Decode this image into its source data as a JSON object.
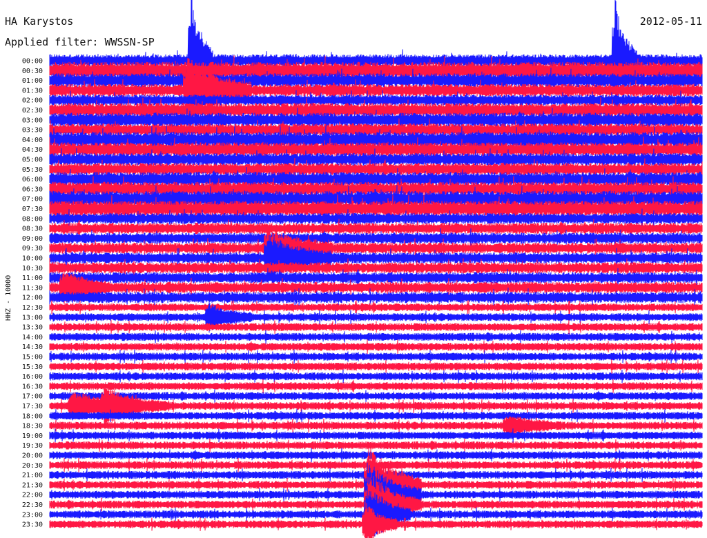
{
  "station": "HA Karystos",
  "date": "2012-05-11",
  "filter_label": "Applied filter: WWSSN-SP",
  "channel_label": "HHZ - 10000",
  "colors": {
    "red": "#ff1744",
    "blue": "#1a1aff"
  },
  "chart_data": {
    "type": "line",
    "title": "HA Karystos",
    "subtitle": "Applied filter: WWSSN-SP",
    "ylabel": "HHZ - 10000",
    "xlabel": "",
    "time_labels": [
      "00:00",
      "00:30",
      "01:00",
      "01:30",
      "02:00",
      "02:30",
      "03:00",
      "03:30",
      "04:00",
      "04:30",
      "05:00",
      "05:30",
      "06:00",
      "06:30",
      "07:00",
      "07:30",
      "08:00",
      "08:30",
      "09:00",
      "09:30",
      "10:00",
      "10:30",
      "11:00",
      "11:30",
      "12:00",
      "12:30",
      "13:00",
      "13:30",
      "14:00",
      "14:30",
      "15:00",
      "15:30",
      "16:00",
      "16:30",
      "17:00",
      "17:30",
      "18:00",
      "18:30",
      "19:00",
      "19:30",
      "20:00",
      "20:30",
      "21:00",
      "21:30",
      "22:00",
      "22:30",
      "23:00",
      "23:30"
    ],
    "trace_colors": [
      "blue",
      "red"
    ],
    "noise_level": [
      8,
      11,
      9,
      8,
      7,
      9,
      9,
      8,
      10,
      9,
      8,
      8,
      9,
      9,
      10,
      10,
      7,
      7,
      7,
      7,
      7,
      7,
      7,
      7,
      7,
      5,
      5,
      5,
      5,
      5,
      5,
      5,
      5,
      5,
      5,
      5,
      5,
      5,
      5,
      5,
      5,
      5,
      5,
      5,
      5,
      5,
      5,
      5
    ],
    "events": [
      {
        "trace": "00:00",
        "minute": 6.5,
        "amplitude": 90,
        "duration": 1.0
      },
      {
        "trace": "00:00",
        "minute": 26.0,
        "amplitude": 85,
        "duration": 1.0
      },
      {
        "trace": "01:30",
        "minute": 6.3,
        "amplitude": 40,
        "duration": 3.0
      },
      {
        "trace": "09:30",
        "minute": 10.0,
        "amplitude": 25,
        "duration": 3.0
      },
      {
        "trace": "10:00",
        "minute": 10.0,
        "amplitude": 28,
        "duration": 3.0
      },
      {
        "trace": "11:30",
        "minute": 0.6,
        "amplitude": 22,
        "duration": 2.0
      },
      {
        "trace": "13:00",
        "minute": 7.3,
        "amplitude": 18,
        "duration": 2.0
      },
      {
        "trace": "17:30",
        "minute": 1.0,
        "amplitude": 18,
        "duration": 3.0
      },
      {
        "trace": "17:30",
        "minute": 2.5,
        "amplitude": 20,
        "duration": 3.0
      },
      {
        "trace": "18:30",
        "minute": 21.0,
        "amplitude": 12,
        "duration": 2.5
      },
      {
        "trace": "21:30",
        "minute": 14.6,
        "amplitude": 55,
        "duration": 2.5
      },
      {
        "trace": "22:00",
        "minute": 14.6,
        "amplitude": 45,
        "duration": 2.5
      },
      {
        "trace": "22:30",
        "minute": 14.6,
        "amplitude": 45,
        "duration": 2.5
      },
      {
        "trace": "23:00",
        "minute": 14.6,
        "amplitude": 40,
        "duration": 2.0
      },
      {
        "trace": "23:30",
        "minute": 14.5,
        "amplitude": 28,
        "duration": 1.5
      }
    ]
  }
}
